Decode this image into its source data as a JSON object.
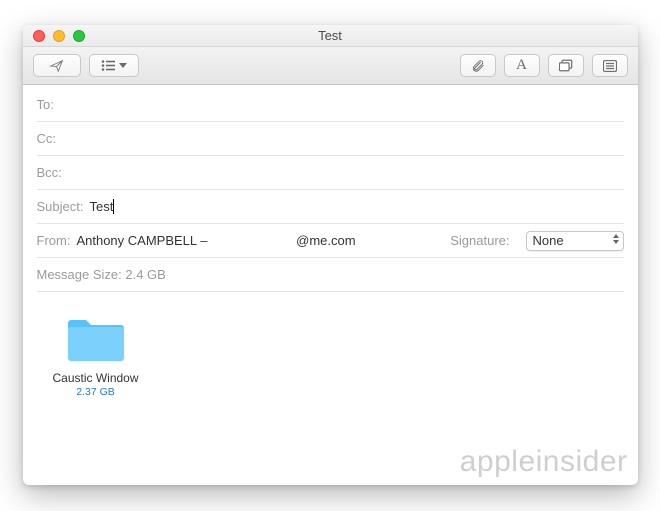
{
  "window": {
    "title": "Test"
  },
  "toolbar": {},
  "fields": {
    "to": {
      "label": "To:",
      "value": ""
    },
    "cc": {
      "label": "Cc:",
      "value": ""
    },
    "bcc": {
      "label": "Bcc:",
      "value": ""
    },
    "subject": {
      "label": "Subject:",
      "value": "Test"
    },
    "from": {
      "label": "From:",
      "name": "Anthony CAMPBELL –",
      "emailSuffix": "@me.com"
    },
    "signature": {
      "label": "Signature:",
      "value": "None"
    },
    "messageSize": {
      "text": "Message Size: 2.4 GB"
    }
  },
  "attachment": {
    "name": "Caustic Window",
    "size": "2.37 GB"
  },
  "watermark": "appleinsider"
}
